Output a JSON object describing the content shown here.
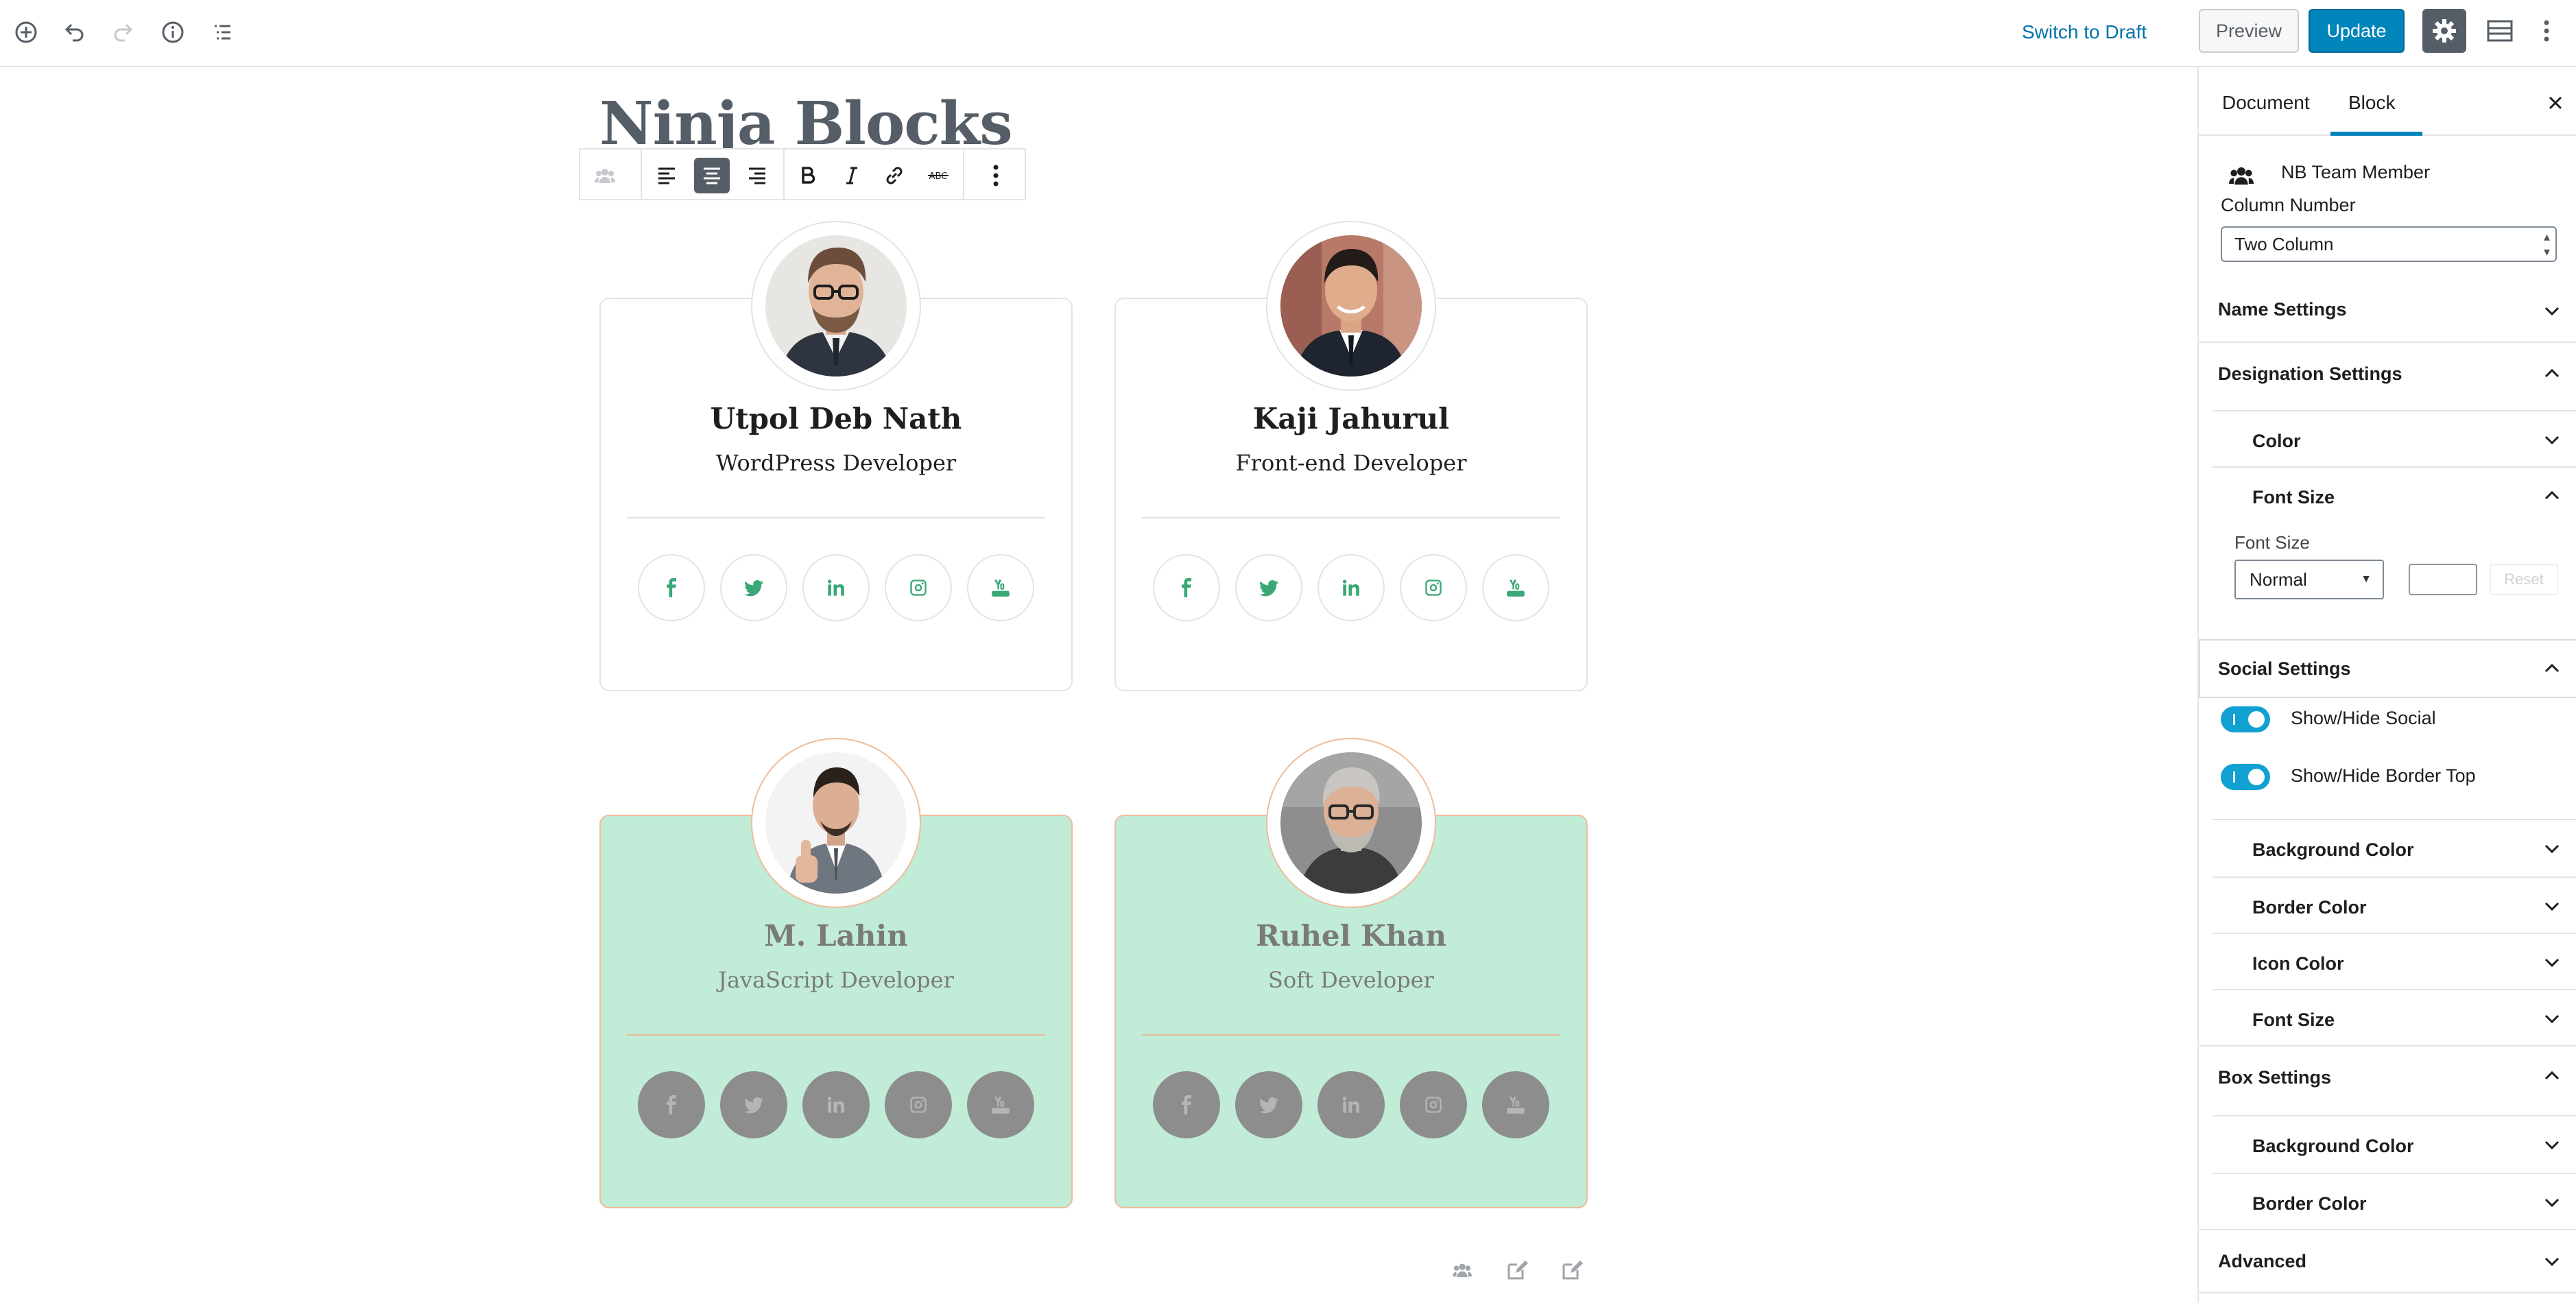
{
  "toolbar": {
    "icons": [
      "add-block-icon",
      "undo-icon",
      "redo-icon",
      "info-icon",
      "outline-icon"
    ],
    "switch_to_draft": "Switch to Draft",
    "preview": "Preview",
    "update": "Update",
    "right_icons": [
      "gear-icon",
      "fullwidth-icon",
      "more-vertical-icon"
    ]
  },
  "editor": {
    "title": "Ninja Blocks",
    "block_toolbar": {
      "buttons": [
        "block-type-icon",
        "align-left-icon",
        "align-center-icon",
        "align-right-icon",
        "bold-icon",
        "italic-icon",
        "link-icon",
        "strikethrough-icon",
        "more-options-icon"
      ],
      "active": "align-center-icon",
      "strike_label": "ABC"
    },
    "members": [
      {
        "name": "Utpol Deb Nath",
        "role": "WordPress Developer",
        "highlighted": false,
        "avatar_bg": "#e8e6e3"
      },
      {
        "name": "Kaji Jahurul",
        "role": "Front-end Developer",
        "highlighted": false,
        "avatar_bg": "#b87968"
      },
      {
        "name": "M. Lahin",
        "role": "JavaScript Developer",
        "highlighted": true,
        "avatar_bg": "#f3f3f3"
      },
      {
        "name": "Ruhel Khan",
        "role": "Soft Developer",
        "highlighted": true,
        "avatar_bg": "#8e8e8e"
      }
    ],
    "social_icons": [
      "facebook-icon",
      "twitter-icon",
      "linkedin-icon",
      "instagram-icon",
      "youtube-icon"
    ],
    "social_glyphs": [
      "f",
      "t",
      "in",
      "ig",
      "yt"
    ],
    "bottom_icons": [
      "team-member-icon",
      "edit-icon",
      "edit-alt-icon"
    ]
  },
  "sidebar": {
    "tabs": [
      "Document",
      "Block"
    ],
    "active_tab": "Block",
    "block_name": "NB Team Member",
    "column_number_label": "Column Number",
    "column_number_value": "Two Column",
    "panels": {
      "name_settings": "Name Settings",
      "designation_settings": "Designation Settings",
      "color": "Color",
      "font_size": "Font Size",
      "font_size_field_label": "Font Size",
      "font_size_value": "Normal",
      "reset": "Reset",
      "social_settings": "Social Settings",
      "show_hide_social": "Show/Hide Social",
      "show_hide_border_top": "Show/Hide Border Top",
      "background_color": "Background Color",
      "border_color": "Border Color",
      "icon_color": "Icon Color",
      "social_font_size": "Font Size",
      "box_settings": "Box Settings",
      "box_background_color": "Background Color",
      "box_border_color": "Border Color",
      "advanced": "Advanced"
    }
  },
  "colors": {
    "accent": "#0085ba",
    "link": "#0073aa",
    "social_green": "#3aa876",
    "card_highlight_bg": "#c1ecd7",
    "card_highlight_border": "#f0bb98",
    "toggle_on": "#11a0d2"
  }
}
